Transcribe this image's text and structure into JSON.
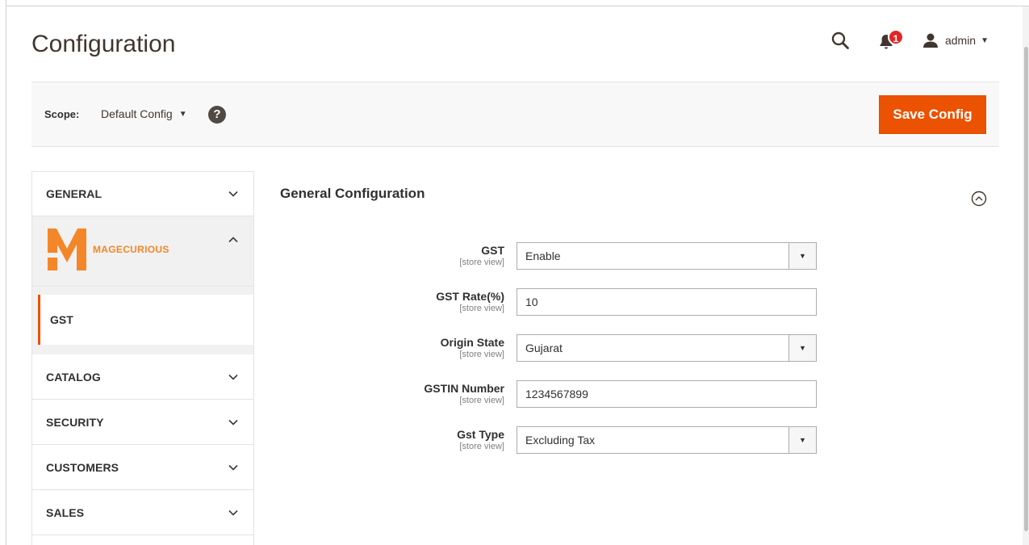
{
  "header": {
    "title": "Configuration",
    "notifications_count": "1",
    "user_label": "admin"
  },
  "actions": {
    "scope_label": "Scope:",
    "scope_value": "Default Config",
    "help_glyph": "?",
    "save_label": "Save Config"
  },
  "sidebar": {
    "tabs_top": [
      {
        "label": "GENERAL"
      }
    ],
    "brand": {
      "text": "MAGECURIOUS"
    },
    "sub_items": [
      {
        "label": "GST"
      }
    ],
    "tabs_bottom": [
      {
        "label": "CATALOG"
      },
      {
        "label": "SECURITY"
      },
      {
        "label": "CUSTOMERS"
      },
      {
        "label": "SALES"
      }
    ]
  },
  "main": {
    "section_title": "General Configuration",
    "fields": [
      {
        "label": "GST",
        "scope": "[store view]",
        "value": "Enable",
        "type": "select"
      },
      {
        "label": "GST Rate(%)",
        "scope": "[store view]",
        "value": "10",
        "type": "text"
      },
      {
        "label": "Origin State",
        "scope": "[store view]",
        "value": "Gujarat",
        "type": "select"
      },
      {
        "label": "GSTIN Number",
        "scope": "[store view]",
        "value": "1234567899",
        "type": "text"
      },
      {
        "label": "Gst Type",
        "scope": "[store view]",
        "value": "Excluding Tax",
        "type": "select"
      }
    ]
  },
  "colors": {
    "accent": "#eb5202",
    "brand": "#f4862a",
    "badge": "#e22626"
  },
  "icons": [
    "search-icon",
    "bell-icon",
    "user-icon",
    "help-icon",
    "chevron-down-icon",
    "chevron-up-icon",
    "collapse-icon",
    "select-arrow-icon"
  ]
}
